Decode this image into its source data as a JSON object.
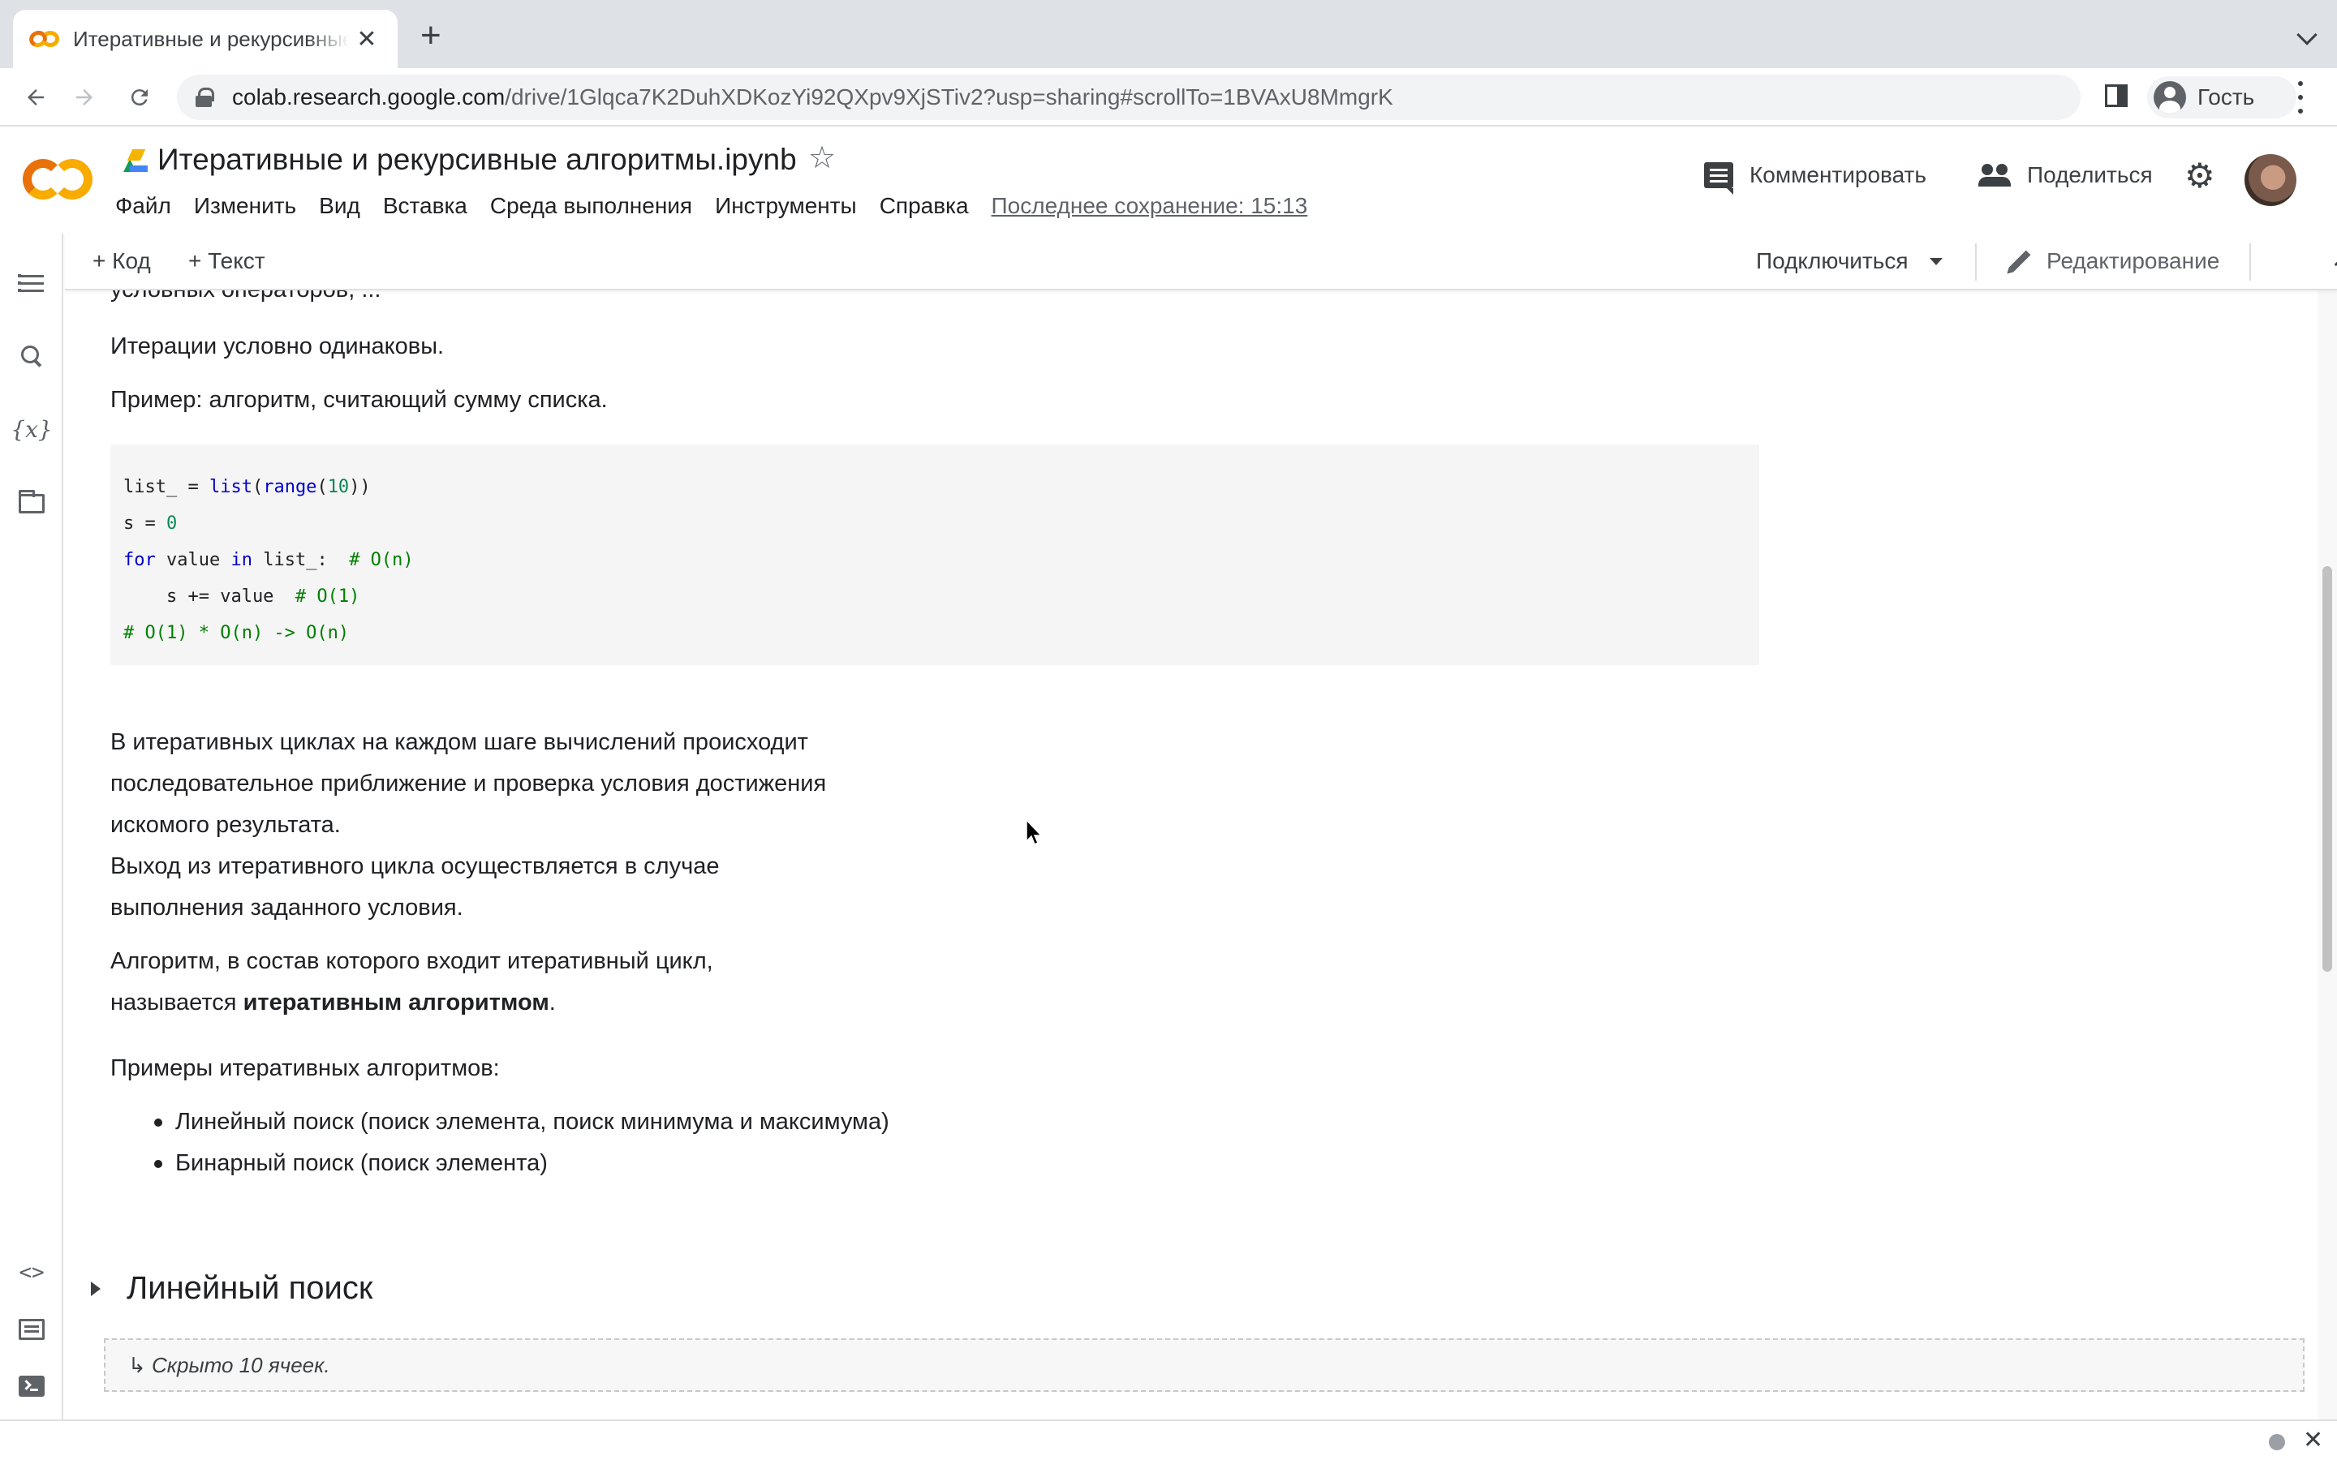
{
  "browser": {
    "tab_title": "Итеративные и рекурсивные алгоритмы.ipynb",
    "tab_close": "✕",
    "new_tab": "+",
    "url_host": "colab.research.google.com",
    "url_path": "/drive/1Glqca7K2DuhXDKozYi92QXpv9XjSTiv2?usp=sharing#scrollTo=1BVAxU8MmgrK",
    "profile_label": "Гость",
    "icons": [
      "back-icon",
      "forward-icon",
      "reload-icon",
      "lock-icon",
      "side-panel-icon",
      "profile-icon",
      "kebab-menu-icon"
    ]
  },
  "colab": {
    "doc_title": "Итеративные и рекурсивные алгоритмы.ipynb",
    "menu": [
      "Файл",
      "Изменить",
      "Вид",
      "Вставка",
      "Среда выполнения",
      "Инструменты",
      "Справка"
    ],
    "last_save": "Последнее сохранение: 15:13",
    "comment_label": "Комментировать",
    "share_label": "Поделиться",
    "toolbar": {
      "add_code": "+ Код",
      "add_text": "+ Текст",
      "connect": "Подключиться",
      "edit_mode": "Редактирование"
    }
  },
  "notebook": {
    "cut_line": "условных операторов, ...",
    "p1": "Итерации условно одинаковы.",
    "p2": "Пример: алгоритм, считающий сумму списка.",
    "code": {
      "line1_a": "list_ = ",
      "line1_b": "list",
      "line1_c": "(",
      "line1_d": "range",
      "line1_e": "(",
      "line1_f": "10",
      "line1_g": "))",
      "line2_a": "s = ",
      "line2_b": "0",
      "line3_a": "for",
      "line3_b": " value ",
      "line3_c": "in",
      "line3_d": " list_:  ",
      "line3_e": "# O(n)",
      "line4_a": "    s += value  ",
      "line4_b": "# O(1)",
      "line5": "# O(1) * O(n) -> O(n)"
    },
    "p3_l1": "В итеративных циклах на каждом шаге вычислений происходит",
    "p3_l2": "последовательное приближение и проверка условия достижения",
    "p3_l3": "искомого результата.",
    "p3_l4": "Выход из итеративного цикла осуществляется в случае",
    "p3_l5": "выполнения заданного условия.",
    "p4_l1": "Алгоритм, в состав которого входит итеративный цикл,",
    "p4_l2_a": "называется ",
    "p4_l2_b": "итеративным алгоритмом",
    "p4_l2_c": ".",
    "p5": "Примеры итеративных алгоритмов:",
    "bullets": [
      "Линейный поиск (поиск элемента, поиск минимума и максимума)",
      "Бинарный поиск (поиск элемента)"
    ],
    "section_title": "Линейный поиск",
    "hidden_cells": "↳ Скрыто 10 ячеек."
  }
}
